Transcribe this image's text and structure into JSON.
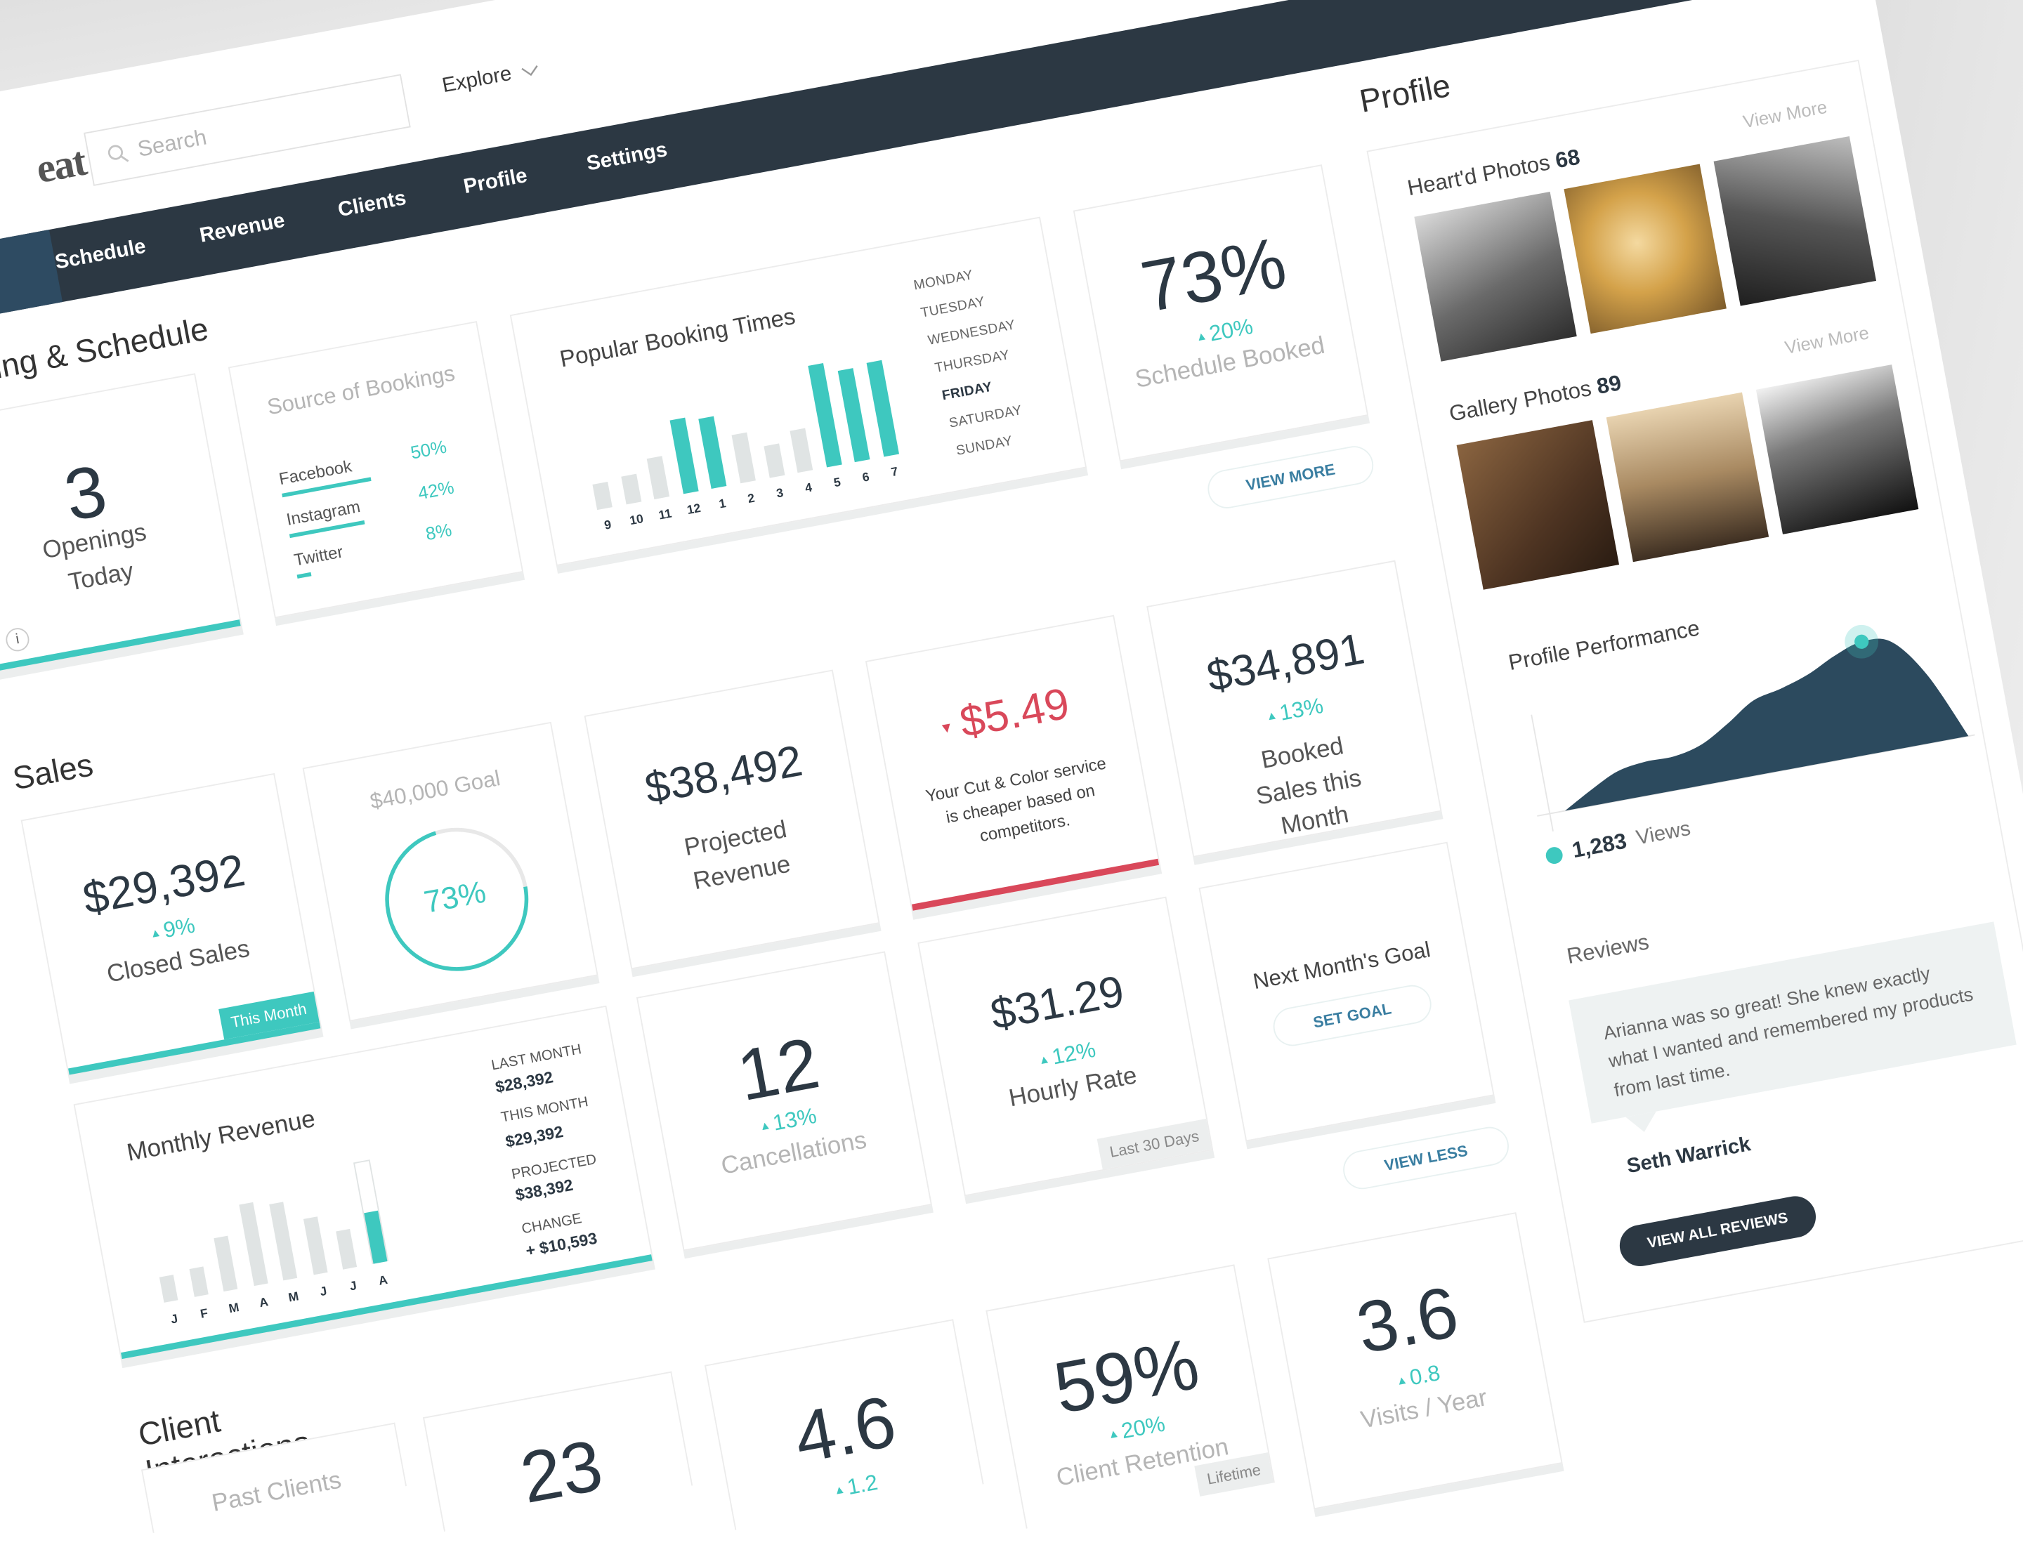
{
  "header": {
    "logo_text": "eat",
    "search_placeholder": "Search",
    "explore_label": "Explore"
  },
  "nav": {
    "items": [
      "Schedule",
      "Revenue",
      "Clients",
      "Profile",
      "Settings"
    ]
  },
  "booking": {
    "title": "Booking & Schedule",
    "openings": {
      "value": "3",
      "label": "Openings Today"
    },
    "source": {
      "title": "Source of Bookings",
      "items": [
        {
          "name": "Facebook",
          "pct": "50%",
          "share": 50
        },
        {
          "name": "Instagram",
          "pct": "42%",
          "share": 42
        },
        {
          "name": "Twitter",
          "pct": "8%",
          "share": 8
        }
      ]
    },
    "popular": {
      "title": "Popular Booking Times",
      "hours": [
        "9",
        "10",
        "11",
        "12",
        "1",
        "2",
        "3",
        "4",
        "5",
        "6",
        "7"
      ],
      "values": [
        20,
        22,
        32,
        58,
        55,
        38,
        25,
        33,
        80,
        72,
        74
      ],
      "highlight": [
        false,
        false,
        false,
        true,
        true,
        false,
        false,
        false,
        true,
        true,
        true
      ],
      "days": [
        "MONDAY",
        "TUESDAY",
        "WEDNESDAY",
        "THURSDAY",
        "FRIDAY",
        "SATURDAY",
        "SUNDAY"
      ],
      "selected_day": "FRIDAY"
    },
    "schedule_booked": {
      "value": "73%",
      "change": "20%",
      "label": "Schedule Booked"
    },
    "view_more": "VIEW MORE"
  },
  "sales": {
    "title": "Sales",
    "closed": {
      "value": "$29,392",
      "change": "9%",
      "label": "Closed Sales",
      "tag": "This Month"
    },
    "goal": {
      "title": "$40,000 Goal",
      "pct_label": "73%",
      "progress": 0.73
    },
    "projected": {
      "value": "$38,492",
      "label": "Projected Revenue"
    },
    "price": {
      "value": "$5.49",
      "note": "Your Cut & Color service is cheaper based on competitors."
    },
    "booked": {
      "value": "$34,891",
      "change": "13%",
      "label": "Booked Sales this Month"
    },
    "monthly": {
      "title": "Monthly Revenue",
      "months": [
        "J",
        "F",
        "M",
        "A",
        "M",
        "J",
        "J",
        "A"
      ],
      "values": [
        20,
        22,
        42,
        64,
        60,
        44,
        30,
        40
      ],
      "projected_last": 80,
      "stats": [
        {
          "label": "LAST MONTH",
          "value": "$28,392"
        },
        {
          "label": "THIS MONTH",
          "value": "$29,392"
        },
        {
          "label": "PROJECTED",
          "value": "$38,392"
        },
        {
          "label": "CHANGE",
          "value": "+ $10,593"
        }
      ]
    },
    "cancellations": {
      "value": "12",
      "change": "13%",
      "label": "Cancellations"
    },
    "hourly": {
      "value": "$31.29",
      "change": "12%",
      "label": "Hourly Rate",
      "tag": "Last 30 Days"
    },
    "next_goal": {
      "label": "Next Month's Goal",
      "button": "SET GOAL"
    },
    "view_less": "VIEW LESS"
  },
  "clients": {
    "title": "Client Interactions",
    "past": {
      "label": "Past Clients"
    },
    "c2": {
      "value": "23"
    },
    "c3": {
      "value": "4.6",
      "change": "1.2"
    },
    "retention": {
      "value": "59%",
      "change": "20%",
      "label": "Client Retention",
      "tag": "Lifetime"
    },
    "visits": {
      "value": "3.6",
      "change": "0.8",
      "label": "Visits / Year"
    }
  },
  "profile": {
    "title": "Profile",
    "hearted": {
      "label": "Heart'd Photos",
      "count": "68",
      "view_more": "View More"
    },
    "gallery": {
      "label": "Gallery Photos",
      "count": "89",
      "view_more": "View More"
    },
    "performance": {
      "title": "Profile Performance",
      "trend": [
        0,
        14,
        26,
        30,
        30,
        36,
        50,
        66,
        72,
        80,
        92,
        100,
        95,
        60,
        0
      ],
      "views": "1,283",
      "views_label": "Views"
    },
    "reviews": {
      "title": "Reviews",
      "text": "Arianna was so great! She knew exactly what I wanted and remembered my products from last time.",
      "author": "Seth Warrick",
      "button": "VIEW ALL REVIEWS"
    }
  },
  "colors": {
    "accent": "#3ec8bf",
    "nav": "#2c3843",
    "negative": "#d9485a",
    "link": "#3a7ea1",
    "chart": "#2c4a5e"
  }
}
